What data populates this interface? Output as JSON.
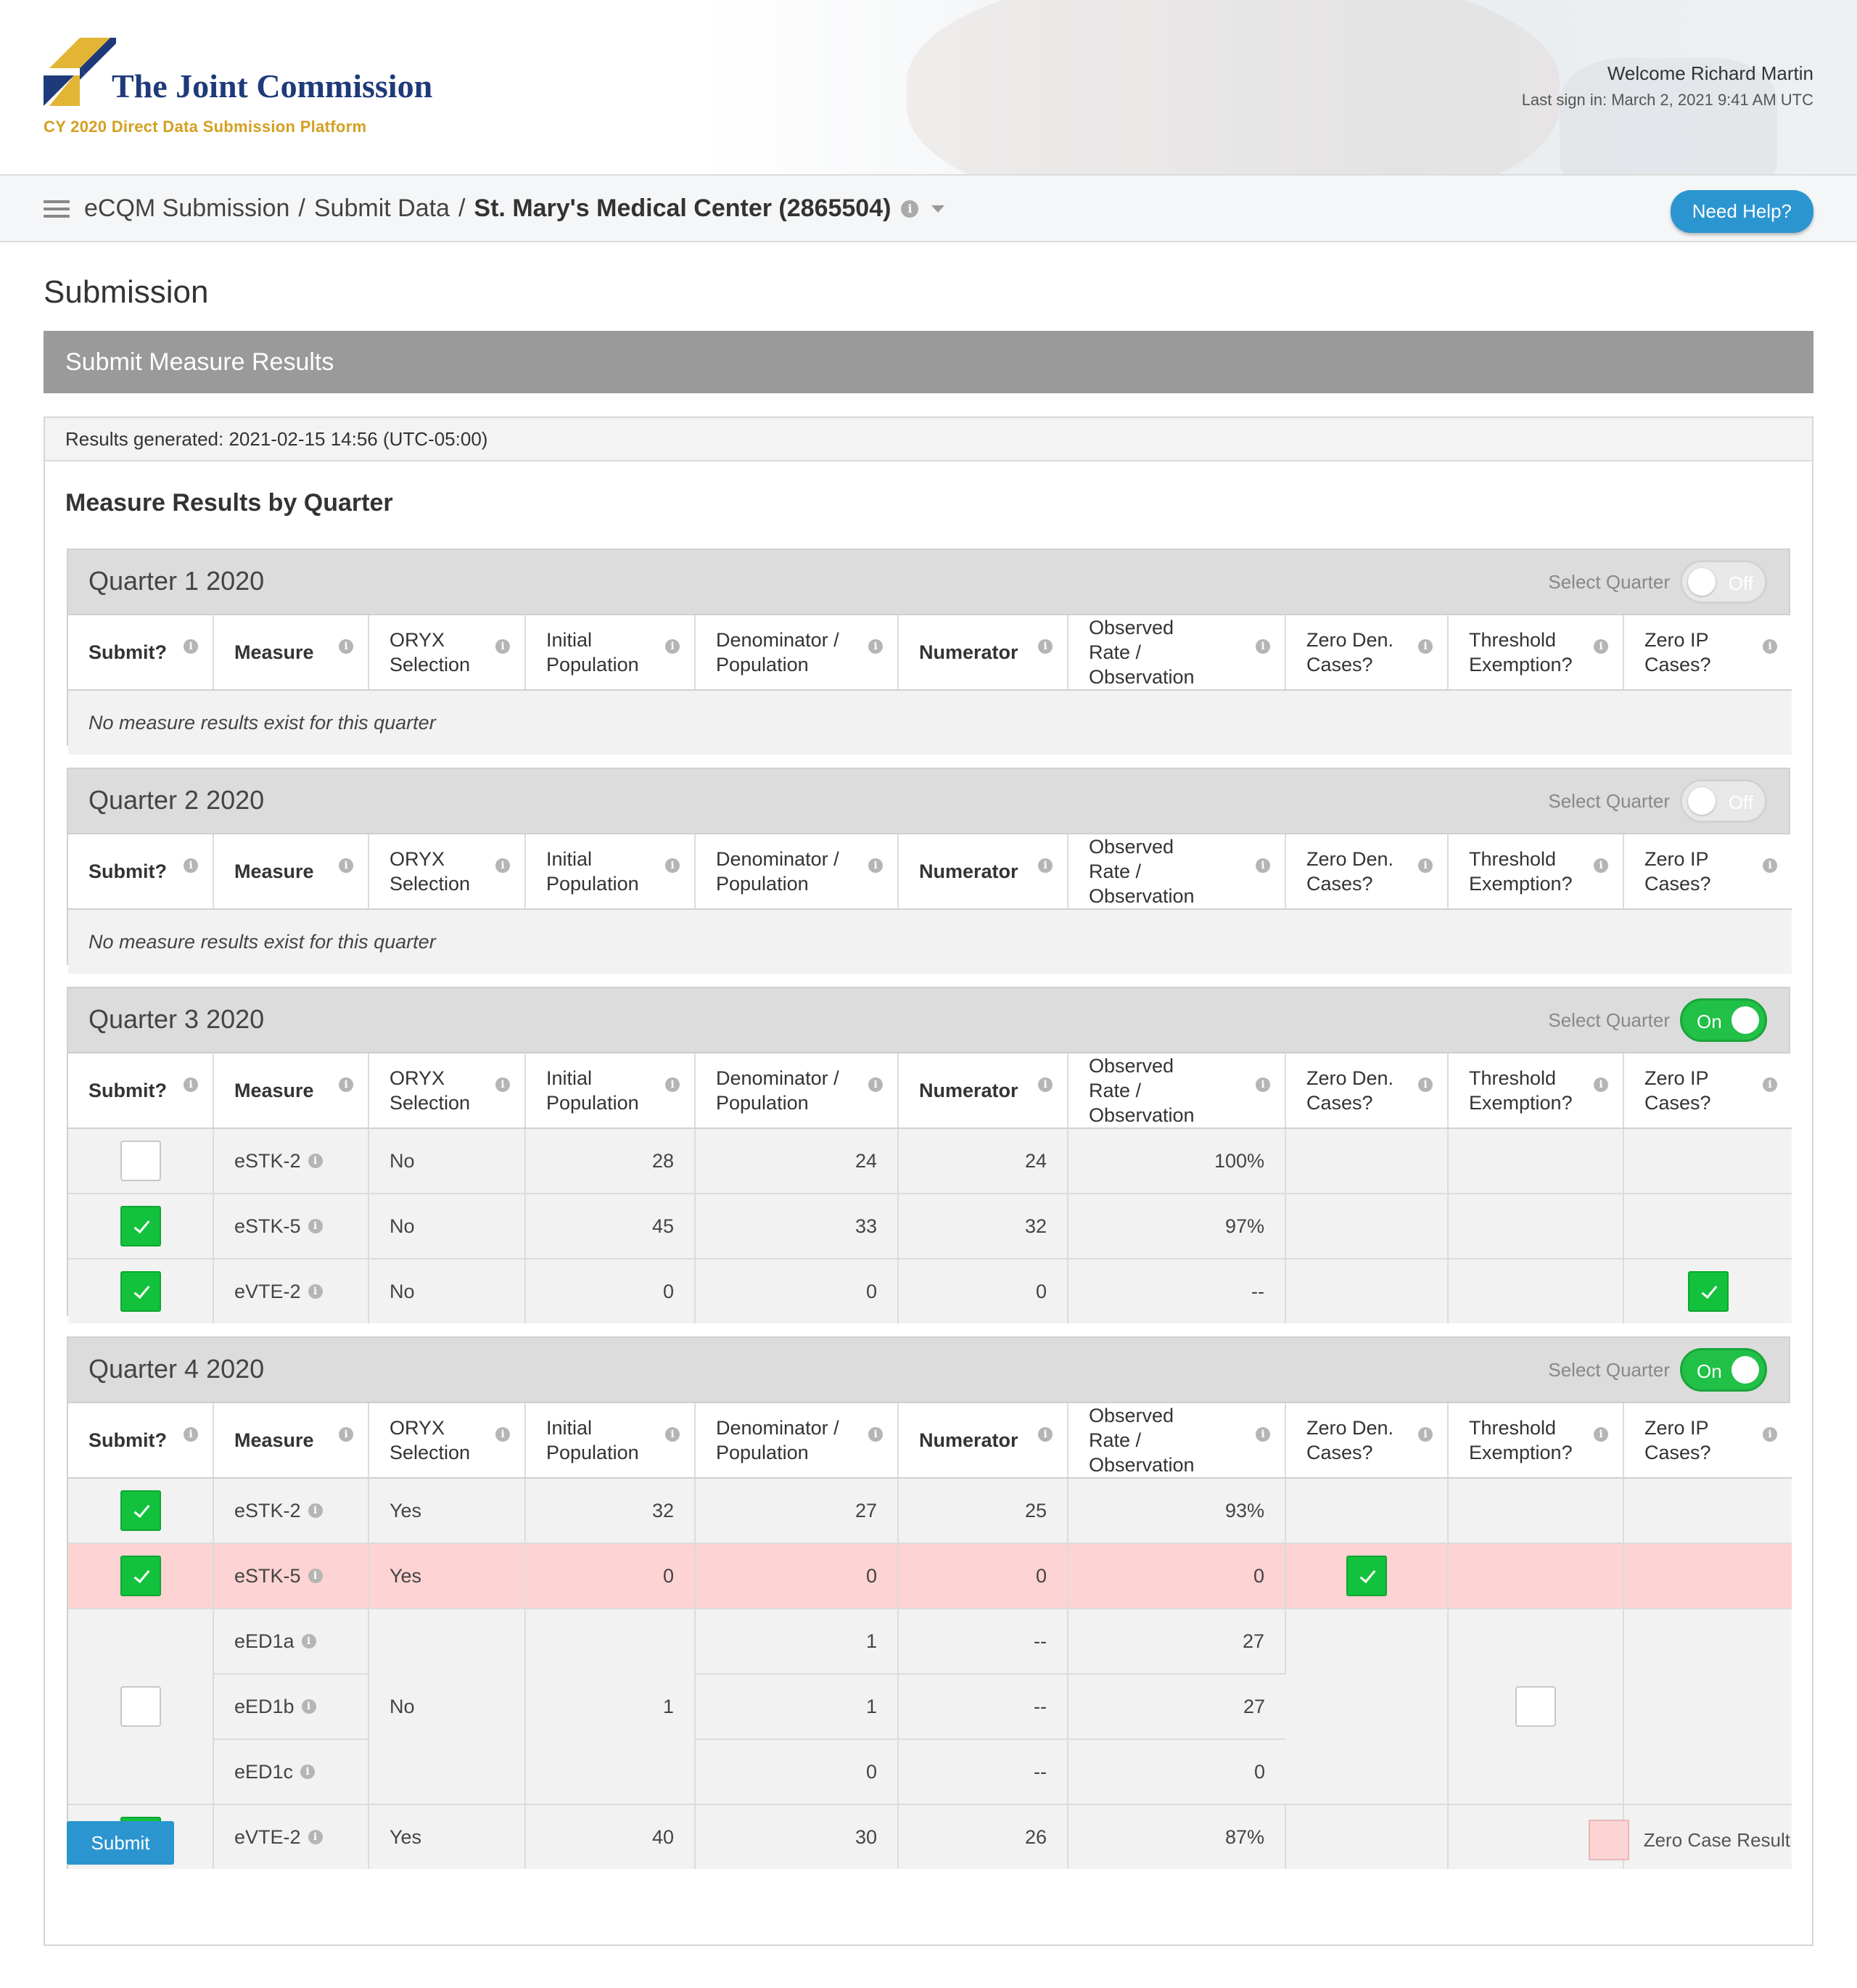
{
  "header": {
    "org_name": "The Joint Commission",
    "platform": "CY 2020 Direct Data Submission Platform",
    "welcome": "Welcome Richard Martin",
    "last_sign_in": "Last sign in: March 2, 2021 9:41 AM UTC"
  },
  "breadcrumb": {
    "items": [
      "eCQM Submission",
      "Submit Data"
    ],
    "current": "St. Mary's Medical Center (2865504)"
  },
  "help_button": "Need Help?",
  "page_title": "Submission",
  "panel_title": "Submit Measure Results",
  "results_generated": "Results generated: 2021-02-15 14:56 (UTC-05:00)",
  "section_title": "Measure Results by Quarter",
  "select_quarter_label": "Select Quarter",
  "columns": [
    "Submit?",
    "Measure",
    "ORYX Selection",
    "Initial Population",
    "Denominator / Population",
    "Numerator",
    "Observed Rate / Observation",
    "Zero Den. Cases?",
    "Threshold Exemption?",
    "Zero IP Cases?"
  ],
  "empty_message": "No measure results exist for this quarter",
  "quarters": [
    {
      "title": "Quarter 1  2020",
      "toggle": "Off"
    },
    {
      "title": "Quarter 2  2020",
      "toggle": "Off"
    },
    {
      "title": "Quarter 3  2020",
      "toggle": "On",
      "rows": [
        {
          "submit": false,
          "measure": "eSTK-2",
          "oryx": "No",
          "ip": "28",
          "den": "24",
          "num": "24",
          "rate": "100%",
          "zero_ip": false
        },
        {
          "submit": true,
          "measure": "eSTK-5",
          "oryx": "No",
          "ip": "45",
          "den": "33",
          "num": "32",
          "rate": "97%",
          "zero_ip": false
        },
        {
          "submit": true,
          "measure": "eVTE-2",
          "oryx": "No",
          "ip": "0",
          "den": "0",
          "num": "0",
          "rate": "--",
          "zero_ip": true
        }
      ]
    },
    {
      "title": "Quarter 4  2020",
      "toggle": "On",
      "rows": [
        {
          "submit": true,
          "measure": "eSTK-2",
          "oryx": "Yes",
          "ip": "32",
          "den": "27",
          "num": "25",
          "rate": "93%"
        },
        {
          "submit": true,
          "measure": "eSTK-5",
          "oryx": "Yes",
          "ip": "0",
          "den": "0",
          "num": "0",
          "rate": "0",
          "zero_den": true,
          "zero_case": true
        }
      ],
      "ed_group": {
        "submit": false,
        "oryx": "No",
        "ip": "1",
        "threshold_exemption": false,
        "sub": [
          {
            "measure": "eED1a",
            "den": "1",
            "num": "--",
            "rate": "27"
          },
          {
            "measure": "eED1b",
            "den": "1",
            "num": "--",
            "rate": "27"
          },
          {
            "measure": "eED1c",
            "den": "0",
            "num": "--",
            "rate": "0"
          }
        ]
      },
      "last_row": {
        "submit": true,
        "measure": "eVTE-2",
        "oryx": "Yes",
        "ip": "40",
        "den": "30",
        "num": "26",
        "rate": "87%"
      }
    }
  ],
  "submit_button": "Submit",
  "legend_label": "Zero Case Result",
  "colors": {
    "brand_blue": "#1e3a7a",
    "brand_gold": "#d4a020",
    "accent": "#2b95d0",
    "check_green": "#12c23c",
    "zero_case": "#fdd3d3"
  }
}
